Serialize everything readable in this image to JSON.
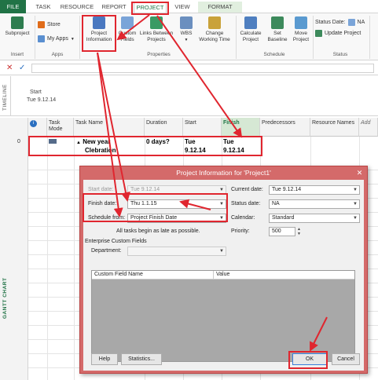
{
  "tabs": [
    "FILE",
    "TASK",
    "RESOURCE",
    "REPORT",
    "PROJECT",
    "VIEW",
    "FORMAT"
  ],
  "ribbon": {
    "subproject": "Subproject",
    "store": "Store",
    "my_apps": "My Apps",
    "project_info_line1": "Project",
    "project_info_line2": "Information",
    "custom_fields_line1": "Custom",
    "custom_fields_line2": "Fields",
    "links_line1": "Links Between",
    "links_line2": "Projects",
    "wbs": "WBS",
    "change_time_line1": "Change",
    "change_time_line2": "Working Time",
    "calculate_line1": "Calculate",
    "calculate_line2": "Project",
    "set_baseline_line1": "Set",
    "set_baseline_line2": "Baseline",
    "move_line1": "Move",
    "move_line2": "Project",
    "status_date_label": "Status Date:",
    "status_date_value": "NA",
    "update_project": "Update Project",
    "groups": {
      "insert": "Insert",
      "apps": "Apps",
      "properties": "Properties",
      "schedule": "Schedule",
      "status": "Status"
    }
  },
  "timeline": {
    "label": "TIMELINE",
    "start_label": "Start",
    "start_date": "Tue 9.12.14"
  },
  "grid": {
    "side_label": "GANTT CHART",
    "headers": {
      "mode": "Task Mode",
      "name": "Task Name",
      "duration": "Duration",
      "start": "Start",
      "finish": "Finish",
      "predecessors": "Predecessors",
      "resources": "Resource Names",
      "add": "Add"
    },
    "row": {
      "id": "0",
      "name_line1": "New year",
      "name_line2": "Clebration",
      "duration": "0 days?",
      "start_line1": "Tue",
      "start_line2": "9.12.14",
      "finish_line1": "Tue",
      "finish_line2": "9.12.14"
    }
  },
  "dialog": {
    "title": "Project Information for 'Project1'",
    "start_date_label": "Start date:",
    "start_date_value": "Tue 9.12.14",
    "finish_date_label": "Finish date:",
    "finish_date_value": "Thu 1.1.15",
    "schedule_from_label": "Schedule from:",
    "schedule_from_value": "Project Finish Date",
    "note": "All tasks begin as late as possible.",
    "current_date_label": "Current date:",
    "current_date_value": "Tue 9.12.14",
    "status_date_label": "Status date:",
    "status_date_value": "NA",
    "calendar_label": "Calendar:",
    "calendar_value": "Standard",
    "priority_label": "Priority:",
    "priority_value": "500",
    "ecf_label": "Enterprise Custom Fields",
    "department_label": "Department:",
    "col_custom_field": "Custom Field Name",
    "col_value": "Value",
    "help": "Help",
    "statistics": "Statistics...",
    "ok": "OK",
    "cancel": "Cancel"
  },
  "colors": {
    "accent": "#217346",
    "annotation": "#e0262f",
    "dialog_frame": "#d46a6a"
  }
}
